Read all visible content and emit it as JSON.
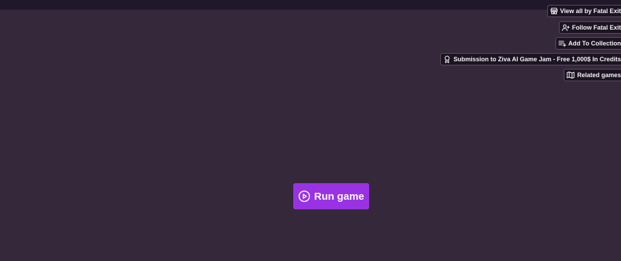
{
  "side_actions": {
    "view_all": {
      "label": "View all by Fatal Exit",
      "icon": "store-icon"
    },
    "follow": {
      "label": "Follow Fatal Exit",
      "icon": "user-plus-icon"
    },
    "add_collection": {
      "label": "Add To Collection",
      "icon": "list-add-icon"
    },
    "submission": {
      "label": "Submission to Ziva AI Game Jam - Free 1,000$ In Credits",
      "icon": "award-icon"
    },
    "related": {
      "label": "Related games",
      "icon": "map-icon"
    }
  },
  "game": {
    "run_label": "Run game",
    "icon": "play-circle-icon",
    "accent_color": "#9932e3"
  },
  "colors": {
    "background": "#34283a",
    "topbar": "#21172a"
  }
}
